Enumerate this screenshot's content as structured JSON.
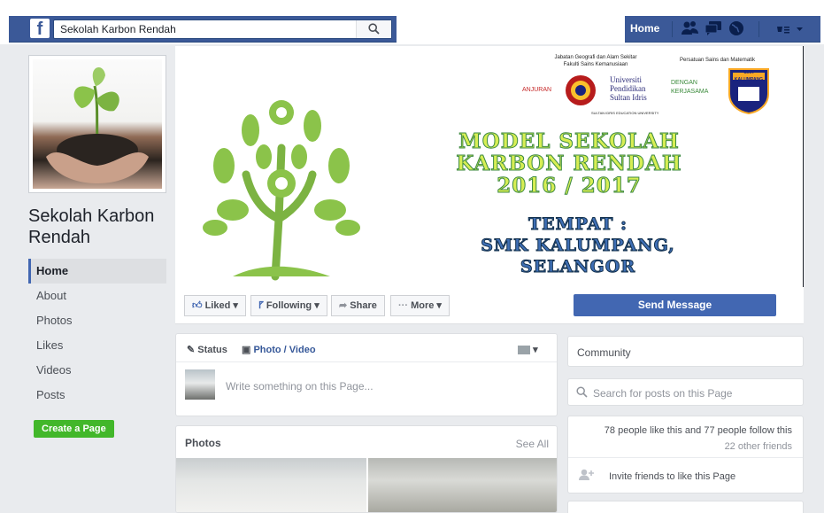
{
  "topbar": {
    "logo": "f",
    "search_value": "Sekolah Karbon Rendah",
    "home": "Home",
    "icons": [
      "friends-icon",
      "messages-icon",
      "notifications-globe-icon",
      "account-menu-icon"
    ]
  },
  "page": {
    "name": "Sekolah Karbon Rendah"
  },
  "left_nav": {
    "items": [
      {
        "label": "Home",
        "active": true
      },
      {
        "label": "About"
      },
      {
        "label": "Photos"
      },
      {
        "label": "Likes"
      },
      {
        "label": "Videos"
      },
      {
        "label": "Posts"
      }
    ],
    "create_page": "Create a Page"
  },
  "cover": {
    "org1_line1": "Jabatan Geografi dan Alam Sekitar",
    "org1_line2": "Fakulti Sains Kemanusiaan",
    "anjuran": "ANJURAN",
    "upsi": [
      "Universiti",
      "Pendidikan",
      "Sultan Idris"
    ],
    "upsi_tagline": "SULTAN IDRIS EDUCATION UNIVERSITY",
    "org2": "Persatuan Sains dan Matematik",
    "dengan_kerjasama": [
      "DENGAN",
      "KERJASAMA"
    ],
    "school_crest": "SMK KALUMPANG",
    "title_lines": [
      "MODEL SEKOLAH",
      "KARBON RENDAH",
      "2016 / 2017"
    ],
    "venue_lines": [
      "TEMPAT :",
      "SMK KALUMPANG,",
      "SELANGOR"
    ]
  },
  "actions": {
    "liked": "Liked",
    "following": "Following",
    "share": "Share",
    "more": "More",
    "send_message": "Send Message"
  },
  "composer": {
    "status": "Status",
    "photo_video": "Photo / Video",
    "placeholder": "Write something on this Page..."
  },
  "photos": {
    "title": "Photos",
    "see_all": "See All"
  },
  "sidebar": {
    "community": "Community",
    "search_placeholder": "Search for posts on this Page",
    "likes_line": "78 people like this and 77 people follow this",
    "friends_line": "22 other friends",
    "invite": "Invite friends to like this Page"
  },
  "colors": {
    "facebook_blue": "#3b5998",
    "button_blue": "#4267b2",
    "create_green": "#42b72a",
    "cover_title_fill": "#d7ee54",
    "cover_title_stroke": "#3d8a42",
    "cover_venue_fill": "#3f6fb5"
  }
}
